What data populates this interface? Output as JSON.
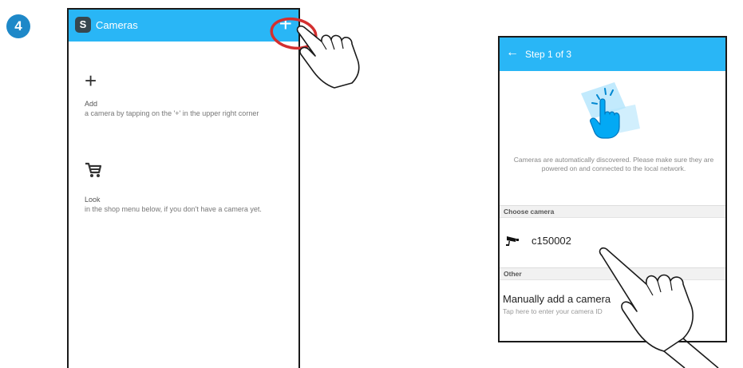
{
  "step_number": "4",
  "phone1": {
    "logo_letter": "S",
    "title": "Cameras",
    "add_button_glyph": "+",
    "add_section": {
      "icon": "plus-icon",
      "title": "Add",
      "description": "a camera by tapping on the '+' in the upper right corner"
    },
    "look_section": {
      "icon": "cart-icon",
      "title": "Look",
      "description": "in the shop menu below, if you don't have a camera yet."
    }
  },
  "phone2": {
    "back_icon": "arrow-left-icon",
    "title": "Step 1 of 3",
    "info_text": "Cameras are automatically discovered. Please make sure they are powered on and connected to the local network.",
    "choose_camera_header": "Choose camera",
    "cameras": [
      {
        "name": "c150002",
        "icon": "security-camera-icon"
      }
    ],
    "other_header": "Other",
    "manual_add": {
      "title": "Manually add a camera",
      "subtitle": "Tap here to enter your camera ID"
    }
  },
  "colors": {
    "header_blue": "#29b6f6",
    "step_badge_blue": "#1e88c8",
    "highlight_red": "#d32f2f"
  }
}
